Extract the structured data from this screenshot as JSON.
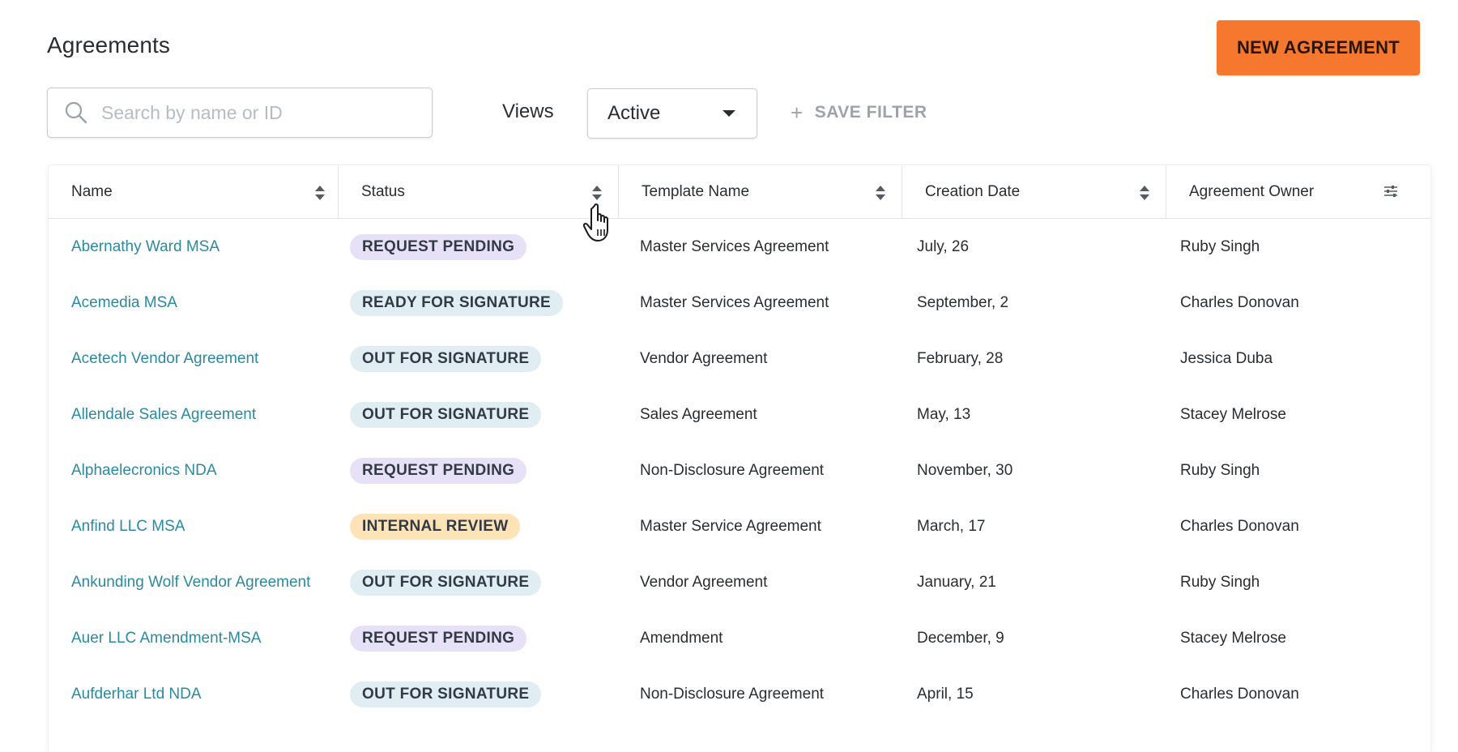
{
  "header": {
    "title": "Agreements",
    "new_button_label": "NEW AGREEMENT"
  },
  "toolbar": {
    "search_placeholder": "Search by name or ID",
    "search_icon": "search-icon",
    "views_label": "Views",
    "views_selected": "Active",
    "save_filter_plus": "+",
    "save_filter_label": "SAVE FILTER"
  },
  "table": {
    "columns": [
      {
        "label": "Name"
      },
      {
        "label": "Status"
      },
      {
        "label": "Template Name"
      },
      {
        "label": "Creation Date"
      },
      {
        "label": "Agreement Owner"
      }
    ],
    "rows": [
      {
        "name": "Abernathy Ward MSA",
        "status": "REQUEST PENDING",
        "status_kind": "pending",
        "template": "Master Services Agreement",
        "date": "July, 26",
        "owner": "Ruby Singh"
      },
      {
        "name": "Acemedia MSA",
        "status": "READY FOR SIGNATURE",
        "status_kind": "ready",
        "template": "Master Services Agreement",
        "date": "September, 2",
        "owner": "Charles Donovan"
      },
      {
        "name": "Acetech Vendor Agreement",
        "status": "OUT FOR SIGNATURE",
        "status_kind": "out",
        "template": "Vendor Agreement",
        "date": "February, 28",
        "owner": "Jessica Duba"
      },
      {
        "name": "Allendale Sales Agreement",
        "status": "OUT FOR SIGNATURE",
        "status_kind": "out",
        "template": "Sales Agreement",
        "date": "May, 13",
        "owner": "Stacey Melrose"
      },
      {
        "name": "Alphaelecronics NDA",
        "status": "REQUEST PENDING",
        "status_kind": "pending",
        "template": "Non-Disclosure Agreement",
        "date": "November, 30",
        "owner": "Ruby Singh"
      },
      {
        "name": "Anfind LLC MSA",
        "status": "INTERNAL REVIEW",
        "status_kind": "review",
        "template": "Master Service Agreement",
        "date": "March, 17",
        "owner": "Charles Donovan"
      },
      {
        "name": "Ankunding Wolf Vendor Agreement",
        "status": "OUT FOR SIGNATURE",
        "status_kind": "out",
        "template": "Vendor Agreement",
        "date": "January, 21",
        "owner": "Ruby Singh"
      },
      {
        "name": "Auer LLC Amendment-MSA",
        "status": "REQUEST PENDING",
        "status_kind": "pending",
        "template": "Amendment",
        "date": "December, 9",
        "owner": "Stacey Melrose"
      },
      {
        "name": "Aufderhar Ltd NDA",
        "status": "OUT FOR SIGNATURE",
        "status_kind": "out",
        "template": "Non-Disclosure Agreement",
        "date": "April, 15",
        "owner": "Charles Donovan"
      }
    ]
  },
  "colors": {
    "accent": "#f5782e",
    "link": "#2a8aa0",
    "badge_pending": "#e6e1f6",
    "badge_out": "#e0edf3",
    "badge_review": "#fde3b5"
  },
  "cursor": "hand-pointer-cursor"
}
